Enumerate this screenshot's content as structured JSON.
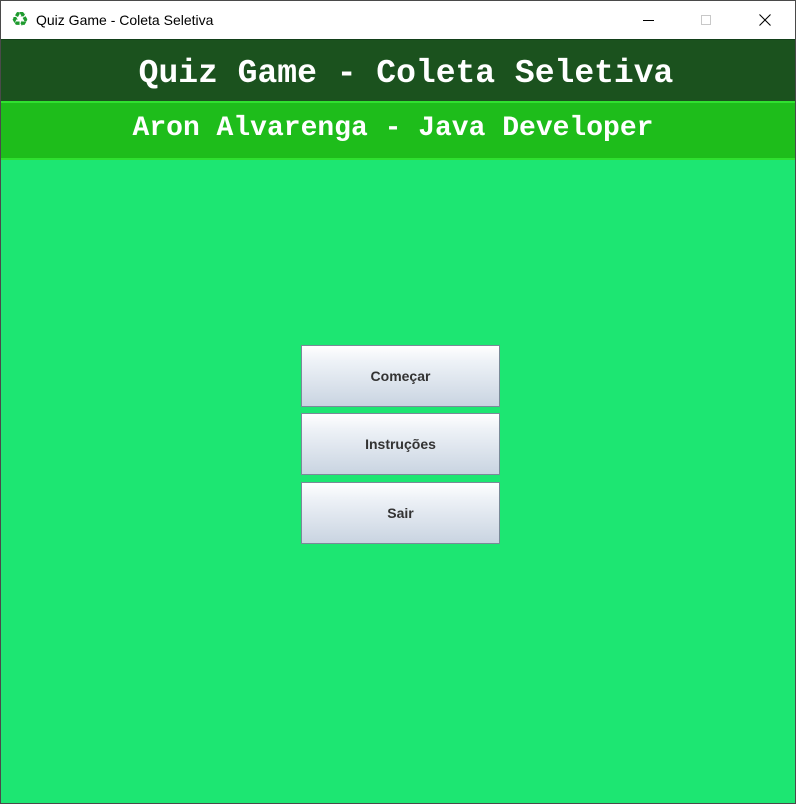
{
  "window": {
    "title": "Quiz Game - Coleta Seletiva",
    "icon": "recycle-icon",
    "controls": [
      "minimize",
      "maximize",
      "close"
    ]
  },
  "header": {
    "title": "Quiz Game - Coleta Seletiva",
    "subtitle": "Aron Alvarenga - Java Developer"
  },
  "menu": {
    "start_label": "Começar",
    "instructions_label": "Instruções",
    "exit_label": "Sair"
  },
  "colors": {
    "header_dark": "#1b521e",
    "header_green": "#1ebd1b",
    "background": "#1de672",
    "button_text": "#333333"
  }
}
